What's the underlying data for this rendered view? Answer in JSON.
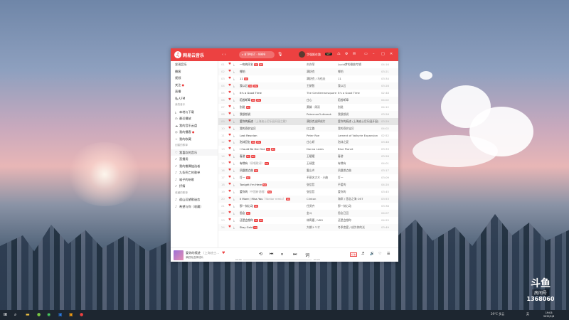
{
  "app": {
    "title": "网易云音乐",
    "search_placeholder": "BTPNST · 9999",
    "username": "华强姬在路",
    "vip": "VIP"
  },
  "colors": {
    "accent": "#ec4141"
  },
  "icons": [
    "logo-icon",
    "search-icon",
    "mic-icon",
    "message-icon",
    "settings-icon",
    "skin-icon",
    "minimize-icon",
    "maximize-icon",
    "close-icon",
    "heart-icon",
    "download-icon",
    "prev-icon",
    "play-pause-icon",
    "next-icon",
    "lyrics-icon",
    "volume-icon",
    "playlist-icon"
  ],
  "sidebar": {
    "items": [
      {
        "label": "发现音乐",
        "type": "item"
      },
      {
        "label": "播客",
        "type": "item"
      },
      {
        "label": "视频",
        "type": "item"
      },
      {
        "label": "关注",
        "type": "item",
        "dot": true
      },
      {
        "label": "直播",
        "type": "item"
      },
      {
        "label": "私人FM",
        "type": "item"
      },
      {
        "label": "我的音乐",
        "type": "group"
      },
      {
        "label": "本地与下载",
        "type": "item",
        "icon": "download-icon"
      },
      {
        "label": "最近播放",
        "type": "item",
        "icon": "clock-icon"
      },
      {
        "label": "我的音乐云盘",
        "type": "item",
        "icon": "cloud-icon"
      },
      {
        "label": "我的播客",
        "type": "item",
        "icon": "podcast-icon",
        "dot": true
      },
      {
        "label": "我的收藏",
        "type": "item",
        "icon": "star-icon"
      },
      {
        "label": "创建的歌单",
        "type": "group"
      },
      {
        "label": "我喜欢的音乐",
        "type": "item",
        "icon": "heart-icon",
        "active": true
      },
      {
        "label": "直播用",
        "type": "item",
        "icon": "playlist-icon"
      },
      {
        "label": "我的眷属抽选者",
        "type": "item",
        "icon": "playlist-icon"
      },
      {
        "label": "九条死亡的歌单",
        "type": "item",
        "icon": "playlist-icon"
      },
      {
        "label": "喵子的听歌",
        "type": "item",
        "icon": "playlist-icon"
      },
      {
        "label": "抒情",
        "type": "item",
        "icon": "playlist-icon"
      },
      {
        "label": "收藏的歌单",
        "type": "group"
      },
      {
        "label": "遥山远望歌迷恋",
        "type": "item",
        "icon": "playlist-icon"
      },
      {
        "label": "希望与你（收藏）",
        "type": "item",
        "icon": "playlist-icon"
      }
    ]
  },
  "songs": [
    {
      "idx": "01",
      "title": "一吻的同名",
      "alias": "",
      "tags": [
        "SQ",
        "MV"
      ],
      "artist": "刘亦菲",
      "album": "Lucid梦的歌曲专辑",
      "duration": "04:16"
    },
    {
      "idx": "02",
      "title": "哪怕",
      "alias": "",
      "tags": [],
      "artist": "满舒克",
      "album": "哪怕",
      "duration": "03:21"
    },
    {
      "idx": "03",
      "title": "11",
      "alias": "",
      "tags": [
        "SQ"
      ],
      "artist": "满舒克 / 马也夫",
      "album": "11",
      "duration": "03:34"
    },
    {
      "idx": "04",
      "title": "我以后",
      "alias": "",
      "tags": [
        "SQ",
        "MV"
      ],
      "artist": "王朗智",
      "album": "我以后",
      "duration": "03:28"
    },
    {
      "idx": "05",
      "title": "It's a Good Time",
      "alias": "",
      "tags": [],
      "artist": "The Gentlemansquare",
      "album": "It's a Good Time",
      "duration": "02:48"
    },
    {
      "idx": "06",
      "title": "稻香断章",
      "alias": "",
      "tags": [
        "SQ",
        "MV"
      ],
      "artist": "庄心",
      "album": "稻香断章",
      "duration": "04:02"
    },
    {
      "idx": "07",
      "title": "别说",
      "alias": "",
      "tags": [
        "SQ"
      ],
      "artist": "黄馨 · 周深",
      "album": "别说",
      "duration": "04:12"
    },
    {
      "idx": "08",
      "title": "我很想说",
      "alias": "",
      "tags": [],
      "artist": "PokemonOutbreak",
      "album": "我很想说",
      "duration": "03:26"
    },
    {
      "idx": "09",
      "title": "爱你的痕迹",
      "alias": "（上海迪士尼乐园开园之歌）",
      "tags": [],
      "artist": "满舒克选择成片",
      "album": "爱你的痕迹 (上海迪士尼乐园开园)",
      "duration": "03:29"
    },
    {
      "idx": "10",
      "title": "我的奇妙宝贝",
      "alias": "",
      "tags": [],
      "artist": "红尘路",
      "album": "我的奇妙宝贝",
      "duration": "04:02"
    },
    {
      "idx": "11",
      "title": "Last Reunion",
      "alias": "",
      "tags": [],
      "artist": "Peter Roe",
      "album": "Lament of Valkyrie Expansion",
      "duration": "02:52"
    },
    {
      "idx": "12",
      "title": "泡沫回忆",
      "alias": "",
      "tags": [
        "SQ",
        "MV"
      ],
      "artist": "庄心妍",
      "album": "泡沫之夏",
      "duration": "03:48"
    },
    {
      "idx": "13",
      "title": "I Could Be the One",
      "alias": "",
      "tags": [
        "SQ",
        "MV"
      ],
      "artist": "Donna Lewis",
      "album": "Blue Planet",
      "duration": "03:33"
    },
    {
      "idx": "14",
      "title": "春游",
      "alias": "",
      "tags": [
        "SQ",
        "MV"
      ],
      "artist": "王暖暖",
      "album": "春游",
      "duration": "03:28"
    },
    {
      "idx": "15",
      "title": "有缘有",
      "alias": "（原唱歌词）",
      "tags": [
        "SQ"
      ],
      "artist": "王靖雯",
      "album": "有缘有",
      "duration": "04:01"
    },
    {
      "idx": "16",
      "title": "凤凰燃点曲",
      "alias": "",
      "tags": [
        "SQ"
      ],
      "artist": "霍山炎",
      "album": "凤凰燃点曲",
      "duration": "03:17"
    },
    {
      "idx": "17",
      "title": "灯一",
      "alias": "",
      "tags": [
        "SQ"
      ],
      "artist": "不慕名大众 · 小曲",
      "album": "灯一",
      "duration": "03:09"
    },
    {
      "idx": "18",
      "title": "Tonight I'm Here",
      "alias": "",
      "tags": [
        "SQ"
      ],
      "artist": "张信哲",
      "album": "不爱的",
      "duration": "04:20"
    },
    {
      "idx": "19",
      "title": "爱你的",
      "alias": "（中国新说唱）",
      "tags": [
        "SQ"
      ],
      "artist": "张信哲",
      "album": "爱你的",
      "duration": "03:45"
    },
    {
      "idx": "20",
      "title": "Il Mare / Miss You",
      "alias": "（Stellar remix）",
      "tags": [
        "SQ"
      ],
      "artist": "Clinton",
      "album": "海岸 / 思念之海 OST",
      "duration": "03:53"
    },
    {
      "idx": "21",
      "title": "那一刻心动",
      "alias": "",
      "tags": [
        "SQ"
      ],
      "artist": "任贤齐",
      "album": "那一刻心动",
      "duration": "03:38"
    },
    {
      "idx": "22",
      "title": "思念",
      "alias": "",
      "tags": [
        "SQ"
      ],
      "artist": "金斗",
      "album": "思念已回",
      "duration": "04:07"
    },
    {
      "idx": "23",
      "title": "还是会想你",
      "alias": "",
      "tags": [
        "SQ",
        "MV"
      ],
      "artist": "林宥嘉 / V8G",
      "album": "还是会想你",
      "duration": "04:25"
    },
    {
      "idx": "24",
      "title": "Stay Gold",
      "alias": "",
      "tags": [
        "SQ"
      ],
      "artist": "大橋トリオ",
      "album": "冬季恋爱 / 成为你的光",
      "duration": "03:49"
    }
  ],
  "player": {
    "title": "爱你的痕迹",
    "alias": "（上海迪士…",
    "artist": "满舒克选择成片",
    "time_elapsed": "00:00",
    "time_total": "03:29",
    "progress": 0.0,
    "quality": "标准"
  },
  "watermark": {
    "logo": "斗鱼",
    "room_label": "房间号",
    "room_number": "1368060"
  },
  "taskbar": {
    "weather": "29°C 多云",
    "lang": "英",
    "time": "19:03",
    "date": "2022/1/8"
  }
}
